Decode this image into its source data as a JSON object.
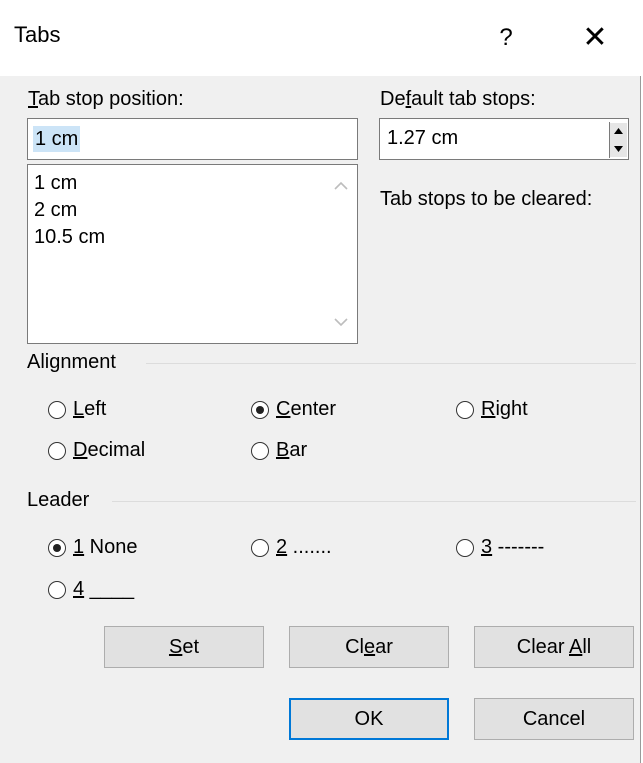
{
  "dialog": {
    "title": "Tabs",
    "help_label": "?",
    "close_label": "✕"
  },
  "tab_stop": {
    "label_prefix": "T",
    "label_rest": "ab stop position:",
    "input_value": "1 cm",
    "list_items": [
      "1 cm",
      "2 cm",
      "10.5 cm"
    ]
  },
  "default_tab_stops": {
    "label_prefix": "De",
    "label_u": "f",
    "label_rest": "ault tab stops:",
    "value": "1.27 cm"
  },
  "tab_stops_cleared_label": "Tab stops to be cleared:",
  "alignment": {
    "group_label": "Alignment",
    "selected": "center",
    "options": [
      {
        "u": "L",
        "rest": "eft"
      },
      {
        "u": "C",
        "rest": "enter"
      },
      {
        "u": "R",
        "rest": "ight"
      },
      {
        "u": "D",
        "rest": "ecimal"
      },
      {
        "u": "B",
        "rest": "ar"
      }
    ]
  },
  "leader": {
    "group_label": "Leader",
    "selected": "1",
    "options": [
      {
        "u": "1",
        "rest": " None"
      },
      {
        "u": "2",
        "rest": " ......."
      },
      {
        "u": "3",
        "rest": " -------"
      },
      {
        "u": "4",
        "rest": " ____"
      }
    ]
  },
  "buttons": {
    "set": {
      "u": "S",
      "rest": "et"
    },
    "clear": {
      "pre": "Cl",
      "u": "e",
      "rest": "ar"
    },
    "clear_all": {
      "pre": "Clear ",
      "u": "A",
      "rest": "ll"
    },
    "ok": "OK",
    "cancel": "Cancel"
  },
  "colors": {
    "selection_bg": "#cce4f7",
    "default_button_border": "#0078d7",
    "dialog_bg": "#f0f0f0"
  }
}
